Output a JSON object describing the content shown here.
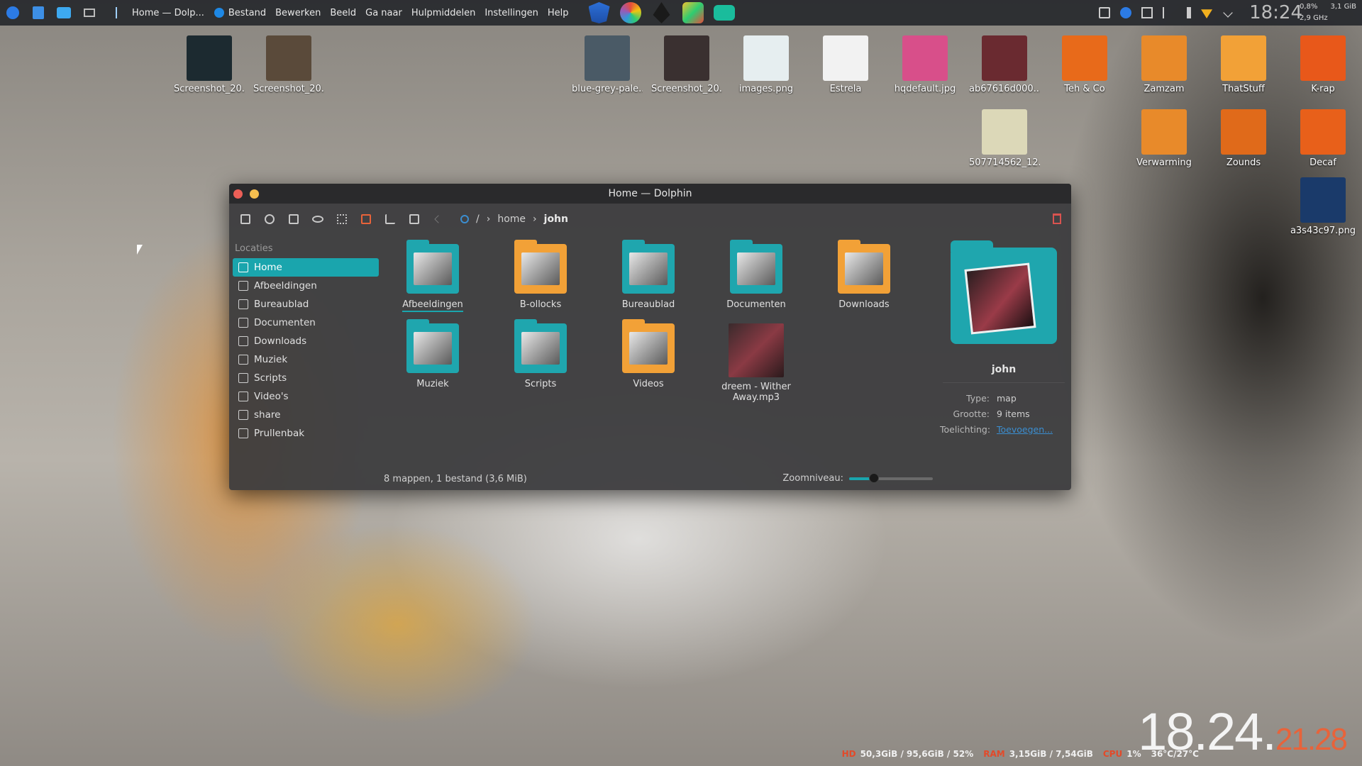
{
  "panel": {
    "window_title": "Home — Dolp...",
    "menu": [
      "Bestand",
      "Bewerken",
      "Beeld",
      "Ga naar",
      "Hulpmiddelen",
      "Instellingen",
      "Help"
    ],
    "clock": "18:24",
    "cpu_load": "0,8%",
    "mem": "3,1 GiB",
    "freq": "2,9 GHz",
    "app_colors": [
      "#1e6fd9",
      "#e8e8e8",
      "#9b59b6",
      "#1a1a1a",
      "#f2c230",
      "#16a085"
    ]
  },
  "desktop_icons": [
    {
      "label": "Screenshot_20...",
      "color": "#1c2a30"
    },
    {
      "label": "Screenshot_20...",
      "color": "#5a4a3a"
    },
    {
      "label": "blue-grey-pale...",
      "color": "#4a5a66"
    },
    {
      "label": "Screenshot_20...",
      "color": "#3a3030"
    },
    {
      "label": "images.png",
      "color": "#e6eef0"
    },
    {
      "label": "Estrela",
      "color": "#f2f2f2"
    },
    {
      "label": "hqdefault.jpg",
      "color": "#d84f8a"
    },
    {
      "label": "ab67616d000...",
      "color": "#6a2a30"
    },
    {
      "label": "Teh & Co",
      "color": "#e86a1a"
    },
    {
      "label": "Zamzam",
      "color": "#e88a2a"
    },
    {
      "label": "ThatStuff",
      "color": "#f2a137"
    },
    {
      "label": "K-rap",
      "color": "#e8581a"
    },
    {
      "label": "507714562_12...",
      "color": "#dcd8b8"
    },
    {
      "label": "Verwarming",
      "color": "#e88a2a"
    },
    {
      "label": "Zounds",
      "color": "#e06a1a"
    },
    {
      "label": "Decaf",
      "color": "#e8601a"
    },
    {
      "label": "a3s43c97.png",
      "color": "#1a3a6a"
    }
  ],
  "window": {
    "title": "Home — Dolphin",
    "breadcrumb": [
      "/",
      "home",
      "john"
    ],
    "sidebar_heading": "Locaties",
    "sidebar": [
      "Home",
      "Afbeeldingen",
      "Bureaublad",
      "Documenten",
      "Downloads",
      "Muziek",
      "Scripts",
      "Video's",
      "share",
      "Prullenbak"
    ],
    "files": [
      {
        "name": "Afbeeldingen",
        "kind": "folder-teal"
      },
      {
        "name": "B-ollocks",
        "kind": "folder-orange"
      },
      {
        "name": "Bureaublad",
        "kind": "folder-teal"
      },
      {
        "name": "Documenten",
        "kind": "folder-teal"
      },
      {
        "name": "Downloads",
        "kind": "folder-orange"
      },
      {
        "name": "Muziek",
        "kind": "folder-teal"
      },
      {
        "name": "Scripts",
        "kind": "folder-teal"
      },
      {
        "name": "Videos",
        "kind": "folder-orange"
      },
      {
        "name": "dreem - Wither Away.mp3",
        "kind": "mp3"
      }
    ],
    "info": {
      "name": "john",
      "type_label": "Type:",
      "type": "map",
      "size_label": "Grootte:",
      "size": "9 items",
      "comment_label": "Toelichting:",
      "comment_link": "Toevoegen..."
    },
    "status": "8 mappen, 1 bestand (3,6 MiB)",
    "zoom_label": "Zoomniveau:",
    "zoom_fraction": 0.3
  },
  "bottom_stats": {
    "hd_label": "HD",
    "hd_value": "50,3GiB / 95,6GiB / 52%",
    "ram_label": "RAM",
    "ram_value": "3,15GiB / 7,54GiB",
    "cpu_label": "CPU",
    "cpu_value": "1%",
    "temp": "36°C/27°C"
  },
  "big_clock": {
    "hm": "18.24.",
    "sec": "21.28"
  }
}
